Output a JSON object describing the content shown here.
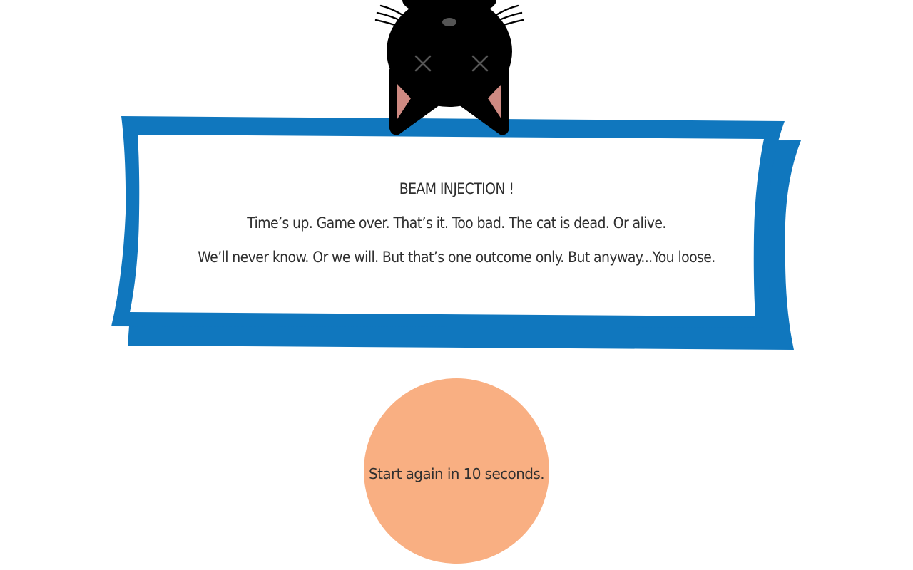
{
  "colors": {
    "frame_blue": "#1077be",
    "panel_white": "#ffffff",
    "button_fill": "#f9af82",
    "cat_fur": "#000000",
    "cat_ear_inner": "#cf8a82",
    "cat_eye_nose": "#555555",
    "text": "#2f2f2f"
  },
  "cat": {
    "state": "dead",
    "icons": [
      "cat-face-icon",
      "cat-eye-x-icon",
      "cat-nose-icon"
    ]
  },
  "message": {
    "title": "BEAM INJECTION !",
    "line1": "Time’s up. Game over. That’s it. Too bad. The cat is dead. Or alive.",
    "line2": "We’ll never know. Or we will. But that’s one outcome only. But anyway...You loose."
  },
  "restart": {
    "label": "Start again in 10 seconds."
  }
}
